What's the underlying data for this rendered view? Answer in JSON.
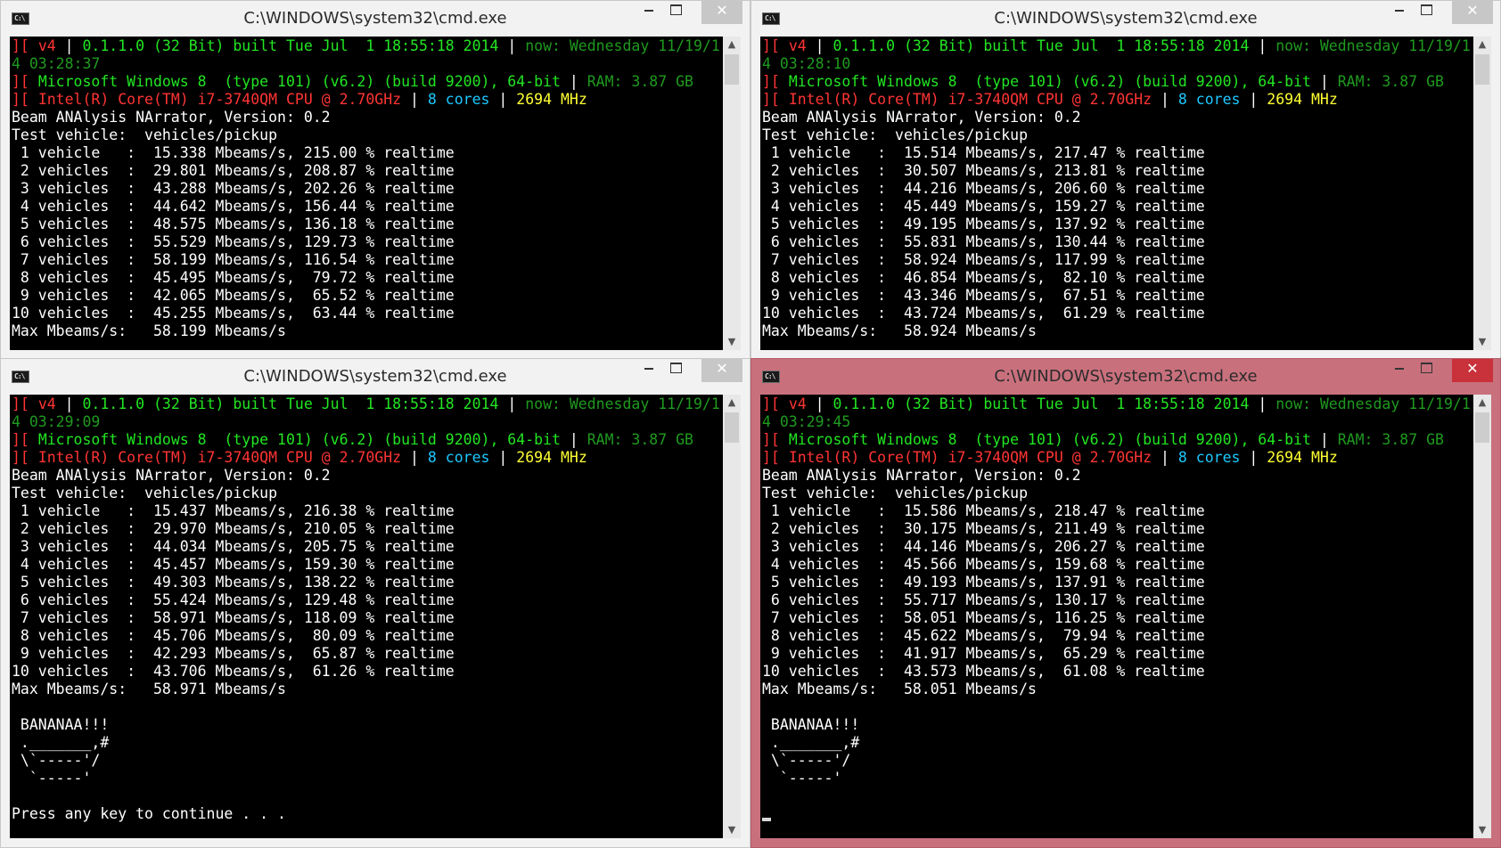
{
  "windows": [
    {
      "title": "C:\\WINDOWS\\system32\\cmd.exe",
      "header": {
        "version": "0.1.1.0 (32 Bit) built Tue Jul  1 18:55:18 2014",
        "now_label": "now: Wednesday 11/19/1",
        "now_cont": "4 03:28:37",
        "os": "Microsoft Windows 8  (type 101) (v6.2) (build 9200), 64-bit",
        "ram": "RAM: 3.87 GB",
        "cpu": "Intel(R) Core(TM) i7-3740QM CPU @ 2.70GHz",
        "cores": "8 cores",
        "mhz": "2694 MHz"
      },
      "body_lines": [
        "Beam ANAlysis NArrator, Version: 0.2",
        "Test vehicle:  vehicles/pickup",
        " 1 vehicle   :  15.338 Mbeams/s, 215.00 % realtime",
        " 2 vehicles  :  29.801 Mbeams/s, 208.87 % realtime",
        " 3 vehicles  :  43.288 Mbeams/s, 202.26 % realtime",
        " 4 vehicles  :  44.642 Mbeams/s, 156.44 % realtime",
        " 5 vehicles  :  48.575 Mbeams/s, 136.18 % realtime",
        " 6 vehicles  :  55.529 Mbeams/s, 129.73 % realtime",
        " 7 vehicles  :  58.199 Mbeams/s, 116.54 % realtime",
        " 8 vehicles  :  45.495 Mbeams/s,  79.72 % realtime",
        " 9 vehicles  :  42.065 Mbeams/s,  65.52 % realtime",
        "10 vehicles  :  45.255 Mbeams/s,  63.44 % realtime",
        "Max Mbeams/s:   58.199 Mbeams/s"
      ]
    },
    {
      "title": "C:\\WINDOWS\\system32\\cmd.exe",
      "header": {
        "version": "0.1.1.0 (32 Bit) built Tue Jul  1 18:55:18 2014",
        "now_label": "now: Wednesday 11/19/1",
        "now_cont": "4 03:28:10",
        "os": "Microsoft Windows 8  (type 101) (v6.2) (build 9200), 64-bit",
        "ram": "RAM: 3.87 GB",
        "cpu": "Intel(R) Core(TM) i7-3740QM CPU @ 2.70GHz",
        "cores": "8 cores",
        "mhz": "2694 MHz"
      },
      "body_lines": [
        "Beam ANAlysis NArrator, Version: 0.2",
        "Test vehicle:  vehicles/pickup",
        " 1 vehicle   :  15.514 Mbeams/s, 217.47 % realtime",
        " 2 vehicles  :  30.507 Mbeams/s, 213.81 % realtime",
        " 3 vehicles  :  44.216 Mbeams/s, 206.60 % realtime",
        " 4 vehicles  :  45.449 Mbeams/s, 159.27 % realtime",
        " 5 vehicles  :  49.195 Mbeams/s, 137.92 % realtime",
        " 6 vehicles  :  55.831 Mbeams/s, 130.44 % realtime",
        " 7 vehicles  :  58.924 Mbeams/s, 117.99 % realtime",
        " 8 vehicles  :  46.854 Mbeams/s,  82.10 % realtime",
        " 9 vehicles  :  43.346 Mbeams/s,  67.51 % realtime",
        "10 vehicles  :  43.724 Mbeams/s,  61.29 % realtime",
        "Max Mbeams/s:   58.924 Mbeams/s"
      ]
    },
    {
      "title": "C:\\WINDOWS\\system32\\cmd.exe",
      "header": {
        "version": "0.1.1.0 (32 Bit) built Tue Jul  1 18:55:18 2014",
        "now_label": "now: Wednesday 11/19/1",
        "now_cont": "4 03:29:09",
        "os": "Microsoft Windows 8  (type 101) (v6.2) (build 9200), 64-bit",
        "ram": "RAM: 3.87 GB",
        "cpu": "Intel(R) Core(TM) i7-3740QM CPU @ 2.70GHz",
        "cores": "8 cores",
        "mhz": "2694 MHz"
      },
      "body_lines": [
        "Beam ANAlysis NArrator, Version: 0.2",
        "Test vehicle:  vehicles/pickup",
        " 1 vehicle   :  15.437 Mbeams/s, 216.38 % realtime",
        " 2 vehicles  :  29.970 Mbeams/s, 210.05 % realtime",
        " 3 vehicles  :  44.034 Mbeams/s, 205.75 % realtime",
        " 4 vehicles  :  45.457 Mbeams/s, 159.30 % realtime",
        " 5 vehicles  :  49.303 Mbeams/s, 138.22 % realtime",
        " 6 vehicles  :  55.424 Mbeams/s, 129.48 % realtime",
        " 7 vehicles  :  58.971 Mbeams/s, 118.09 % realtime",
        " 8 vehicles  :  45.706 Mbeams/s,  80.09 % realtime",
        " 9 vehicles  :  42.293 Mbeams/s,  65.87 % realtime",
        "10 vehicles  :  43.706 Mbeams/s,  61.26 % realtime",
        "Max Mbeams/s:   58.971 Mbeams/s",
        "",
        " BANANAA!!!",
        " ._______,#",
        " \\`-----'/",
        "  `-----'",
        "",
        "Press any key to continue . . ."
      ]
    },
    {
      "title": "C:\\WINDOWS\\system32\\cmd.exe",
      "header": {
        "version": "0.1.1.0 (32 Bit) built Tue Jul  1 18:55:18 2014",
        "now_label": "now: Wednesday 11/19/1",
        "now_cont": "4 03:29:45",
        "os": "Microsoft Windows 8  (type 101) (v6.2) (build 9200), 64-bit",
        "ram": "RAM: 3.87 GB",
        "cpu": "Intel(R) Core(TM) i7-3740QM CPU @ 2.70GHz",
        "cores": "8 cores",
        "mhz": "2694 MHz"
      },
      "body_lines": [
        "Beam ANAlysis NArrator, Version: 0.2",
        "Test vehicle:  vehicles/pickup",
        " 1 vehicle   :  15.586 Mbeams/s, 218.47 % realtime",
        " 2 vehicles  :  30.175 Mbeams/s, 211.49 % realtime",
        " 3 vehicles  :  44.146 Mbeams/s, 206.27 % realtime",
        " 4 vehicles  :  45.566 Mbeams/s, 159.68 % realtime",
        " 5 vehicles  :  49.193 Mbeams/s, 137.91 % realtime",
        " 6 vehicles  :  55.717 Mbeams/s, 130.17 % realtime",
        " 7 vehicles  :  58.051 Mbeams/s, 116.25 % realtime",
        " 8 vehicles  :  45.622 Mbeams/s,  79.94 % realtime",
        " 9 vehicles  :  41.917 Mbeams/s,  65.29 % realtime",
        "10 vehicles  :  43.573 Mbeams/s,  61.08 % realtime",
        "Max Mbeams/s:   58.051 Mbeams/s",
        "",
        " BANANAA!!!",
        " ._______,#",
        " \\`-----'/",
        "  `-----'",
        ""
      ]
    }
  ],
  "common": {
    "prefix": "][",
    "v4": "v4",
    "sep": "|",
    "icon_text": "C:\\"
  },
  "colors": {
    "active_frame": "#c9707d",
    "close_active": "#c9313b",
    "green": "#22e622",
    "dark_green": "#1f9a1f",
    "red": "#ff3434",
    "cyan": "#1ec8ff",
    "yellow": "#ffff33"
  }
}
